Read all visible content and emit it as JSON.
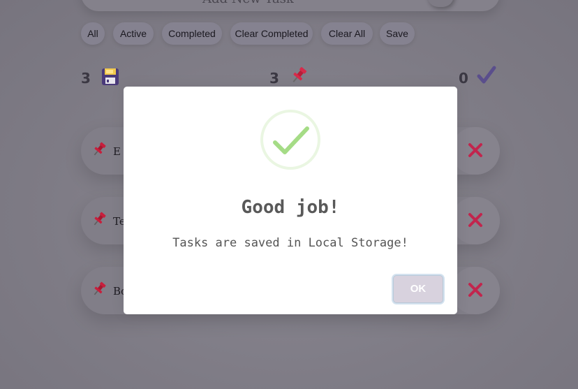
{
  "header": {
    "add_placeholder": "Add New Task"
  },
  "filters": [
    "All",
    "Active",
    "Completed",
    "Clear Completed",
    "Clear All",
    "Save"
  ],
  "stats": {
    "total": "3",
    "pending": "3",
    "completed": "0",
    "icons": [
      "floppy-disk-icon",
      "pushpin-icon",
      "checkmark-icon"
    ]
  },
  "tasks": [
    {
      "label": "E"
    },
    {
      "label": "Te"
    },
    {
      "label": "Bo"
    }
  ],
  "modal": {
    "title": "Good job!",
    "text": "Tasks are saved in Local Storage!",
    "ok_label": "OK"
  },
  "colors": {
    "overlay": "#7e7b85",
    "success_green": "#a5dc86",
    "delete_red": "#c2254d",
    "pin_red": "#c81e3c",
    "check_purple": "#5a4e8c"
  }
}
